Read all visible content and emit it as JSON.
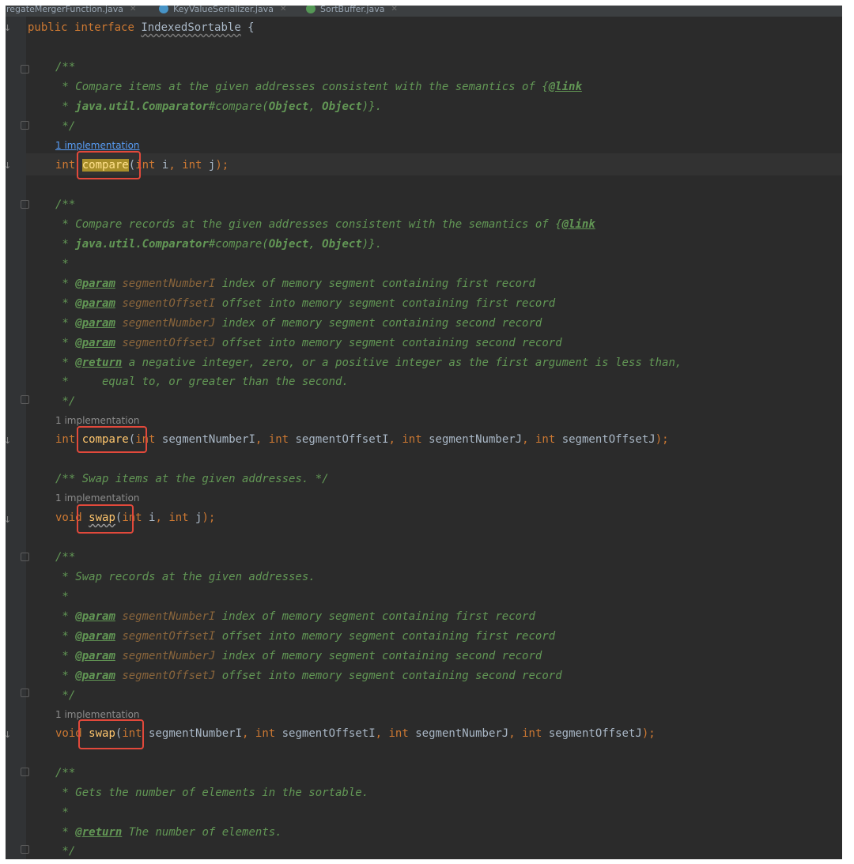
{
  "tabs": [
    {
      "label": "gregateMergerFunction.java",
      "icon": "java-class-icon",
      "color": "#4a86c8"
    },
    {
      "label": "KeyValueSerializer.java",
      "icon": "java-interface-icon",
      "color": "#4aa3df"
    },
    {
      "label": "SortBuffer.java",
      "icon": "java-interface-icon",
      "color": "#5aa85a"
    }
  ],
  "header": {
    "kw_public": "public",
    "kw_interface": "interface",
    "name": "IndexedSortable",
    "brace": " {"
  },
  "doc1": {
    "open": "/**",
    "l1a": " * Compare items at the given addresses consistent with the semantics of ",
    "l1b": "{",
    "l1c": "@link",
    "l2a": " * ",
    "l2b": "java.util.Comparator",
    "l2c": "#compare(",
    "l2d": "Object",
    "l2e": ", ",
    "l2f": "Object",
    "l2g": ")}.",
    "close": " */"
  },
  "hint1": "1 implementation",
  "m1": {
    "ret": "int",
    "name": "compare",
    "p1t": "int",
    "p1": " i",
    "sep": ", ",
    "p2t": "int",
    "p2": " j",
    "end": ");"
  },
  "doc2": {
    "open": "/**",
    "l1a": " * Compare records at the given addresses consistent with the semantics of ",
    "l1b": "{",
    "l1c": "@link",
    "l2a": " * ",
    "l2b": "java.util.Comparator",
    "l2c": "#compare(",
    "l2d": "Object",
    "l2e": ", ",
    "l2f": "Object",
    "l2g": ")}.",
    "blank": " *",
    "params": [
      {
        "tag": "@param",
        "name": "segmentNumberI",
        "desc": " index of memory segment containing first record"
      },
      {
        "tag": "@param",
        "name": "segmentOffsetI",
        "desc": " offset into memory segment containing first record"
      },
      {
        "tag": "@param",
        "name": "segmentNumberJ",
        "desc": " index of memory segment containing second record"
      },
      {
        "tag": "@param",
        "name": "segmentOffsetJ",
        "desc": " offset into memory segment containing second record"
      }
    ],
    "ret_tag": "@return",
    "ret_desc": " a negative integer, zero, or a positive integer as the first argument is less than,",
    "ret_cont": " *     equal to, or greater than the second.",
    "close": " */"
  },
  "hint2": "1 implementation",
  "m2": {
    "ret": "int",
    "name": "compare",
    "pt": "int",
    "a1": " segmentNumberI",
    "a2": " segmentOffsetI",
    "a3": " segmentNumberJ",
    "a4": " segmentOffsetJ",
    "sep": ", ",
    "end": ");"
  },
  "doc3": {
    "text": "/** Swap items at the given addresses. */"
  },
  "hint3": "1 implementation",
  "m3": {
    "ret": "void",
    "name": "swap",
    "p1t": "int",
    "p1": " i",
    "sep": ", ",
    "p2t": "int",
    "p2": " j",
    "end": ");"
  },
  "doc4": {
    "open": "/**",
    "l1": " * Swap records at the given addresses.",
    "blank": " *",
    "params": [
      {
        "tag": "@param",
        "name": "segmentNumberI",
        "desc": " index of memory segment containing first record"
      },
      {
        "tag": "@param",
        "name": "segmentOffsetI",
        "desc": " offset into memory segment containing first record"
      },
      {
        "tag": "@param",
        "name": "segmentNumberJ",
        "desc": " index of memory segment containing second record"
      },
      {
        "tag": "@param",
        "name": "segmentOffsetJ",
        "desc": " offset into memory segment containing second record"
      }
    ],
    "close": " */"
  },
  "hint4": "1 implementation",
  "m4": {
    "ret": "void",
    "name": "swap",
    "pt": "int",
    "a1": " segmentNumberI",
    "a2": " segmentOffsetI",
    "a3": " segmentNumberJ",
    "a4": " segmentOffsetJ",
    "sep": ", ",
    "end": ");"
  },
  "doc5": {
    "open": "/**",
    "l1": " * Gets the number of elements in the sortable.",
    "blank": " *",
    "ret_tag": "@return",
    "ret_desc": " The number of elements.",
    "close": " */"
  },
  "colors": {
    "annotation_box": "#e2493b",
    "highlight": "#a88e2a",
    "background": "#2b2b2b"
  }
}
